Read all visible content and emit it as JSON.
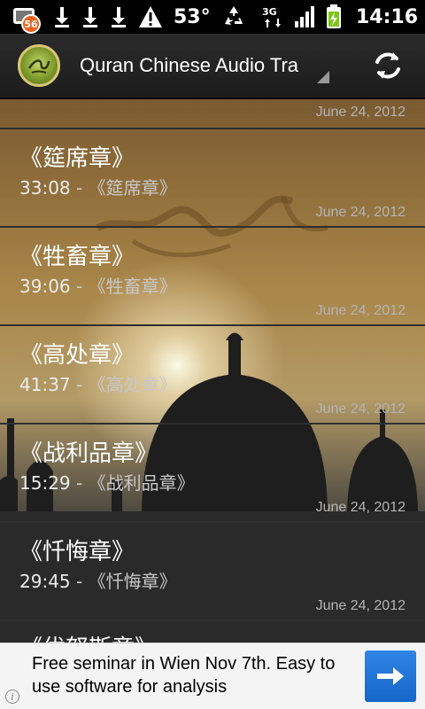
{
  "status_bar": {
    "notification_count": "56",
    "temperature": "53°",
    "network": "3G",
    "time": "14:16",
    "icons": [
      "notification-icon",
      "download-icon",
      "download-icon",
      "download-icon",
      "warning-icon",
      "recycle-icon",
      "network-3g-icon",
      "signal-icon",
      "battery-charging-icon"
    ]
  },
  "action_bar": {
    "title": "Quran Chinese Audio Tra",
    "logo_icon": "quran-logo-icon",
    "refresh_icon": "refresh-icon"
  },
  "list": {
    "first_partial_date": "June 24, 2012",
    "items": [
      {
        "title": "《筵席章》",
        "duration": "33:08",
        "separator": " - ",
        "name": "《筵席章》",
        "date": "June 24, 2012"
      },
      {
        "title": "《牲畜章》",
        "duration": "39:06",
        "separator": " - ",
        "name": "《牲畜章》",
        "date": "June 24, 2012"
      },
      {
        "title": "《高处章》",
        "duration": "41:37",
        "separator": " - ",
        "name": "《高处章》",
        "date": "June 24, 2012"
      },
      {
        "title": "《战利品章》",
        "duration": "15:29",
        "separator": " - ",
        "name": "《战利品章》",
        "date": "June 24, 2012"
      },
      {
        "title": "《忏悔章》",
        "duration": "29:45",
        "separator": " - ",
        "name": "《忏悔章》",
        "date": "June 24, 2012"
      }
    ],
    "last_partial_title": "《优努斯章》"
  },
  "ad": {
    "text": "Free seminar in Wien Nov 7th. Easy to use software for analysis",
    "arrow_icon": "arrow-right-icon",
    "info_icon": "info-icon",
    "info_label": "i"
  },
  "colors": {
    "status_bg": "#000000",
    "action_bar_bg": "#2b2b2b",
    "ad_button": "#2f84e4",
    "badge": "#e8641e"
  }
}
